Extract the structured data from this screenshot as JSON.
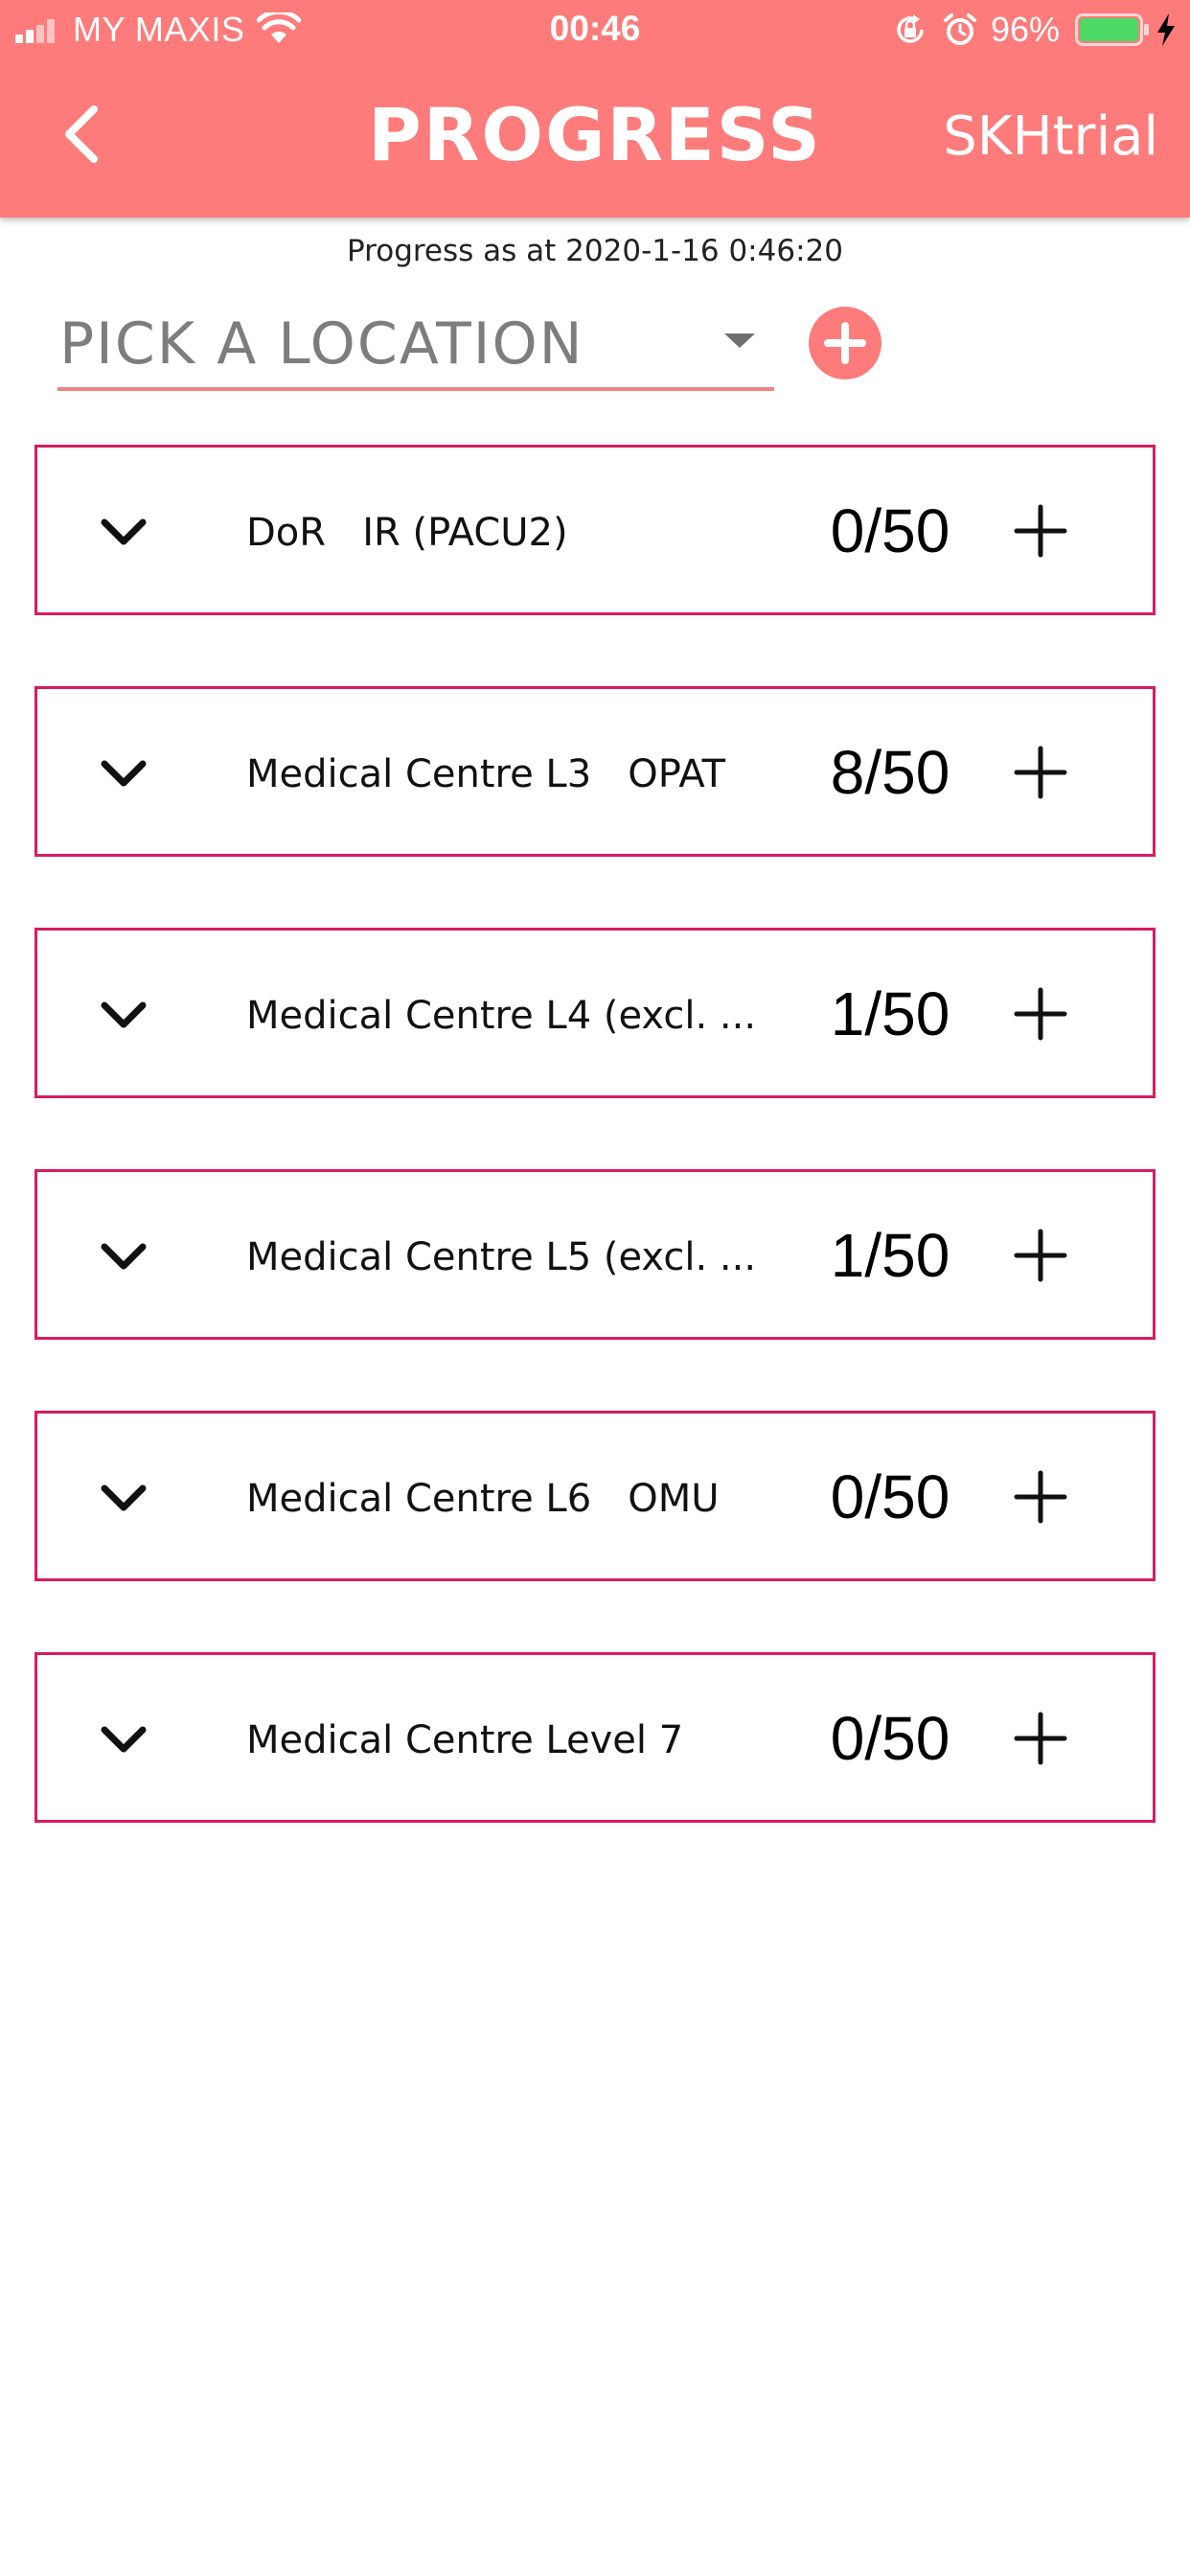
{
  "status_bar": {
    "carrier": "MY MAXIS",
    "time": "00:46",
    "battery": "96%",
    "icons": [
      "signal-icon",
      "wifi-icon",
      "rotation-lock-icon",
      "alarm-icon",
      "battery-icon",
      "charging-icon"
    ],
    "battery_color": "#4cd964"
  },
  "header": {
    "back_icon": "chevron-left-icon",
    "title": "PROGRESS",
    "user": "SKHtrial",
    "background_color": "#fd7b7b"
  },
  "progress_timestamp": "Progress as at 2020-1-16 0:46:20",
  "location_picker": {
    "placeholder": "PICK A LOCATION",
    "add_icon": "plus-circle-icon"
  },
  "accent_color": "#d81b60",
  "locations": [
    {
      "name": "DoR   IR (PACU2)",
      "progress": "0/50"
    },
    {
      "name": "Medical Centre L3   OPAT",
      "progress": "8/50"
    },
    {
      "name": "Medical Centre L4 (excl. ...",
      "progress": "1/50"
    },
    {
      "name": "Medical Centre L5 (excl. ...",
      "progress": "1/50"
    },
    {
      "name": "Medical Centre L6   OMU",
      "progress": "0/50"
    },
    {
      "name": "Medical Centre Level 7",
      "progress": "0/50"
    }
  ]
}
